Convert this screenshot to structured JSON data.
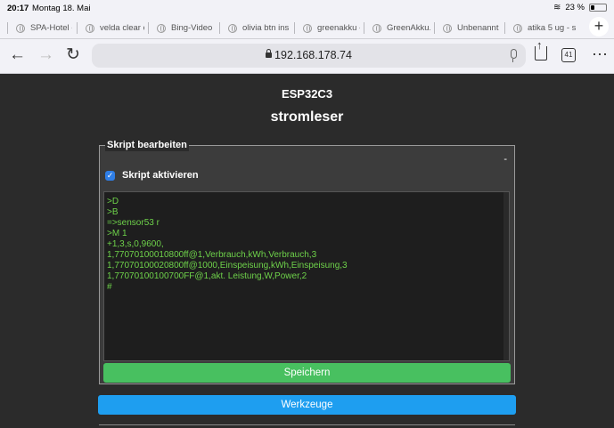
{
  "status_bar": {
    "time": "20:17",
    "date": "Montag 18. Mai",
    "battery": "23 %"
  },
  "tabs": [
    {
      "label": "SPA-Hotel -"
    },
    {
      "label": "velda clear o"
    },
    {
      "label": "Bing-Video"
    },
    {
      "label": "olivia btn ins"
    },
    {
      "label": "greenakku -"
    },
    {
      "label": "GreenAkku.d"
    },
    {
      "label": "Unbenannt"
    },
    {
      "label": "atika 5 ug - s"
    }
  ],
  "toolbar": {
    "url": "192.168.178.74",
    "tab_count": "41"
  },
  "page": {
    "device": "ESP32C3",
    "title": "stromleser"
  },
  "script_panel": {
    "legend": "Skript bearbeiten",
    "collapse_symbol": "-",
    "checkbox_label": "Skript aktivieren",
    "checked": true,
    "code_lines": [
      ">D",
      ">B",
      "=>sensor53 r",
      ">M 1",
      "+1,3,s,0,9600,",
      "1,77070100010800ff@1,Verbrauch,kWh,Verbrauch,3",
      "1,77070100020800ff@1000,Einspeisung,kWh,Einspeisung,3",
      "1,77070100100700FF@1,akt. Leistung,W,Power,2",
      "#"
    ],
    "save_label": "Speichern"
  },
  "tools_label": "Werkzeuge",
  "colors": {
    "background": "#2b2b2b",
    "code": "#6ed24a",
    "save_button": "#48c060",
    "tools_button": "#1e9ef0",
    "checkbox": "#2f7ee6"
  }
}
